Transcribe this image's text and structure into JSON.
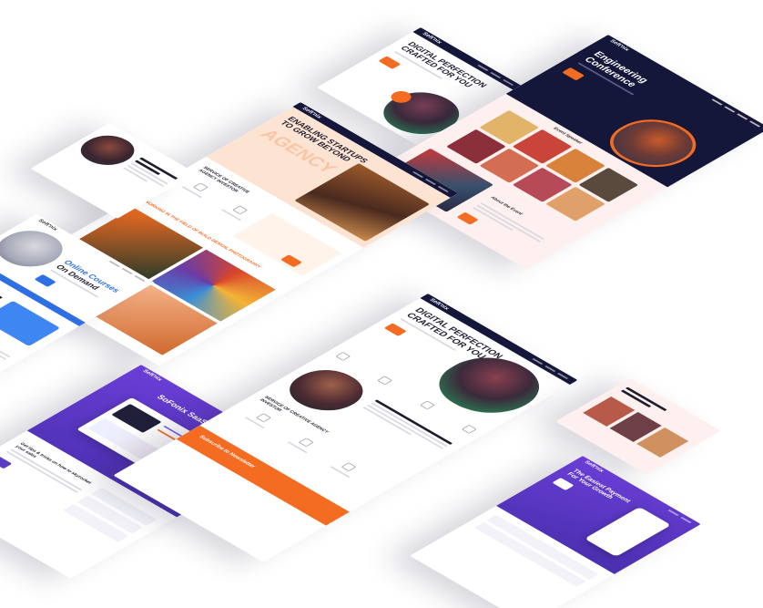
{
  "brand": {
    "logo": "Soft'nix",
    "accent": "#f36c21",
    "navy": "#14163a",
    "purple": "#5b3cc4",
    "blue": "#2f6fe4"
  },
  "cards": {
    "digital_top": {
      "headline_1": "DIGITAL PERFECTION",
      "headline_2": "CRAFTED FOR YOU"
    },
    "conference": {
      "title_1": "Engineering",
      "title_2": "Conference",
      "speakers": "Event Speaker",
      "about": "About the Event"
    },
    "agency": {
      "headline_1": "ENABLING STARTUPS",
      "headline_2": "TO GROW BEYOND",
      "watermark": "AGENCY",
      "services_1": "SERVICE OF CREATIVE",
      "services_2": "AGENCY INVESTOR",
      "portfolio": "WORKING IN THE FIELD OF BUILD DESIGN, PHOTOGRAPHY"
    },
    "courses": {
      "headline_1": "Online Courses",
      "headline_2": "On Demand"
    },
    "saas": {
      "headline": "SoFonix SaaS Platform",
      "sub": "Get tips & tricks on how to skyrocket your sales"
    },
    "digital_main": {
      "headline_1": "DIGITAL PERFECTION",
      "headline_2": "CRAFTED FOR YOU",
      "services_1": "SERVICE OF CREATIVE AGENCY",
      "services_2": "INVESTOR",
      "newsletter": "Subscribe to Newsletter"
    },
    "payments": {
      "headline_1": "The Easiest Payment",
      "headline_2": "For Your Growth"
    }
  }
}
